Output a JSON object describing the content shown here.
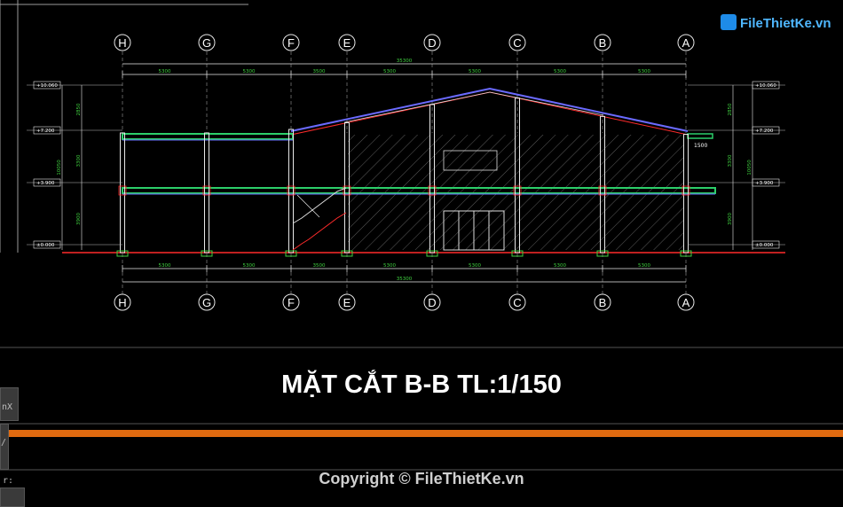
{
  "drawing": {
    "title": "MẶT CẮT B-B TL:1/150",
    "copyright": "Copyright © FileThietKe.vn",
    "watermark": "FileThietKe.vn",
    "grid_axes": [
      "H",
      "G",
      "F",
      "E",
      "D",
      "C",
      "B",
      "A"
    ],
    "top_spans": [
      "5300",
      "5300",
      "3500",
      "5300",
      "5300",
      "5300",
      "5300"
    ],
    "overall_span": "35300",
    "level_labels": [
      "+10.060",
      "+7.200",
      "+3.900",
      "±0.000"
    ],
    "height_dims": [
      "2850",
      "3300",
      "3900"
    ],
    "total_height": "10050",
    "canopy_dim": "1500"
  },
  "side_panel": {
    "label_a": "nX",
    "label_b": "/",
    "label_c": "r:"
  },
  "colors": {
    "background": "#000000",
    "line": "#e8e8e8",
    "dim": "#3fcf3f",
    "roof": "#6a6aff",
    "red": "#ff2b2b",
    "orange": "#e06a10",
    "slab": "#2ccf6a"
  }
}
